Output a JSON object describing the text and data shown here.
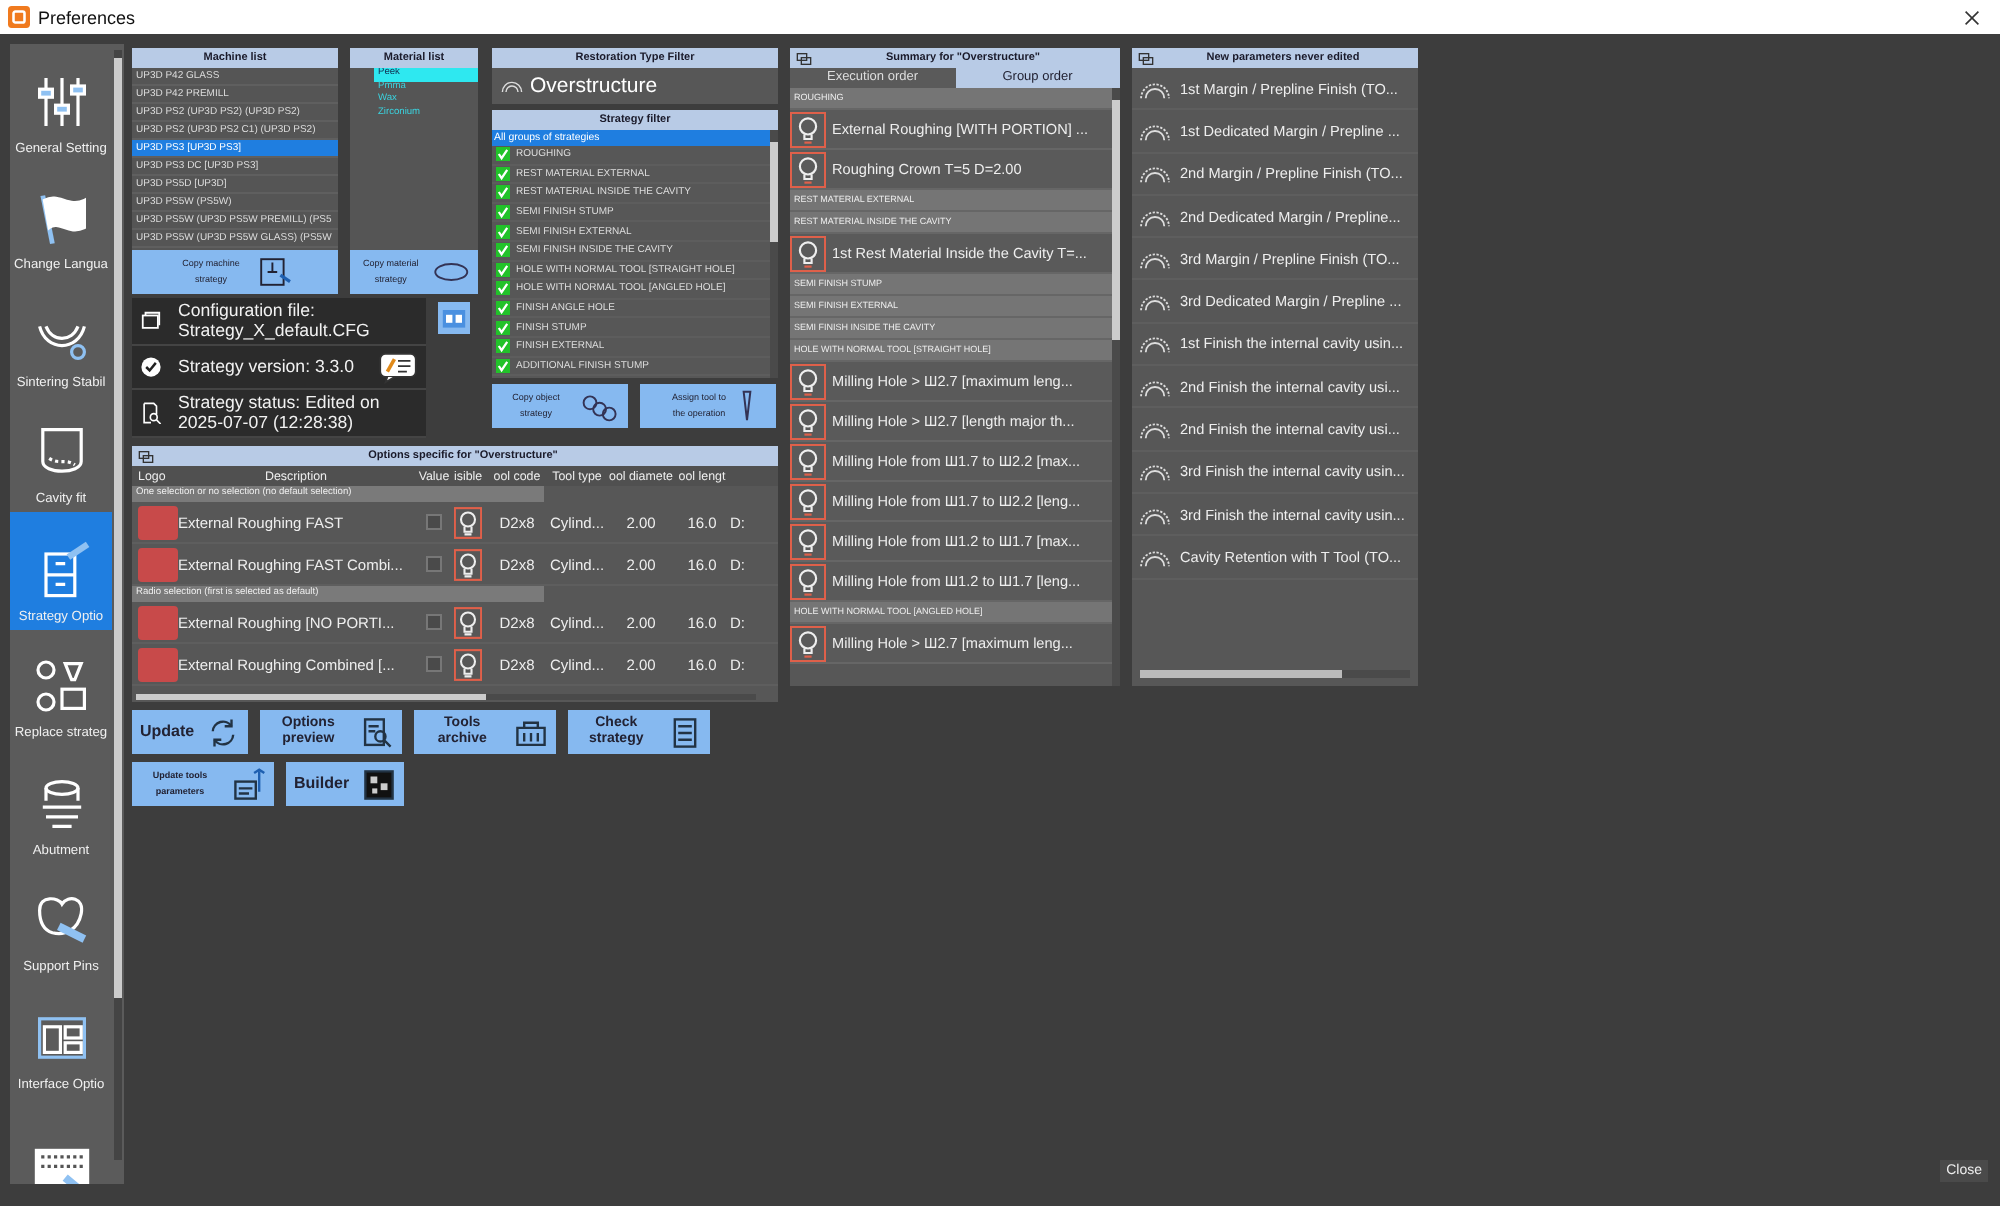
{
  "window": {
    "title": "Preferences"
  },
  "sidebar": {
    "items": [
      {
        "label": "General Setting",
        "kind": "sliders",
        "selected": false
      },
      {
        "label": "Change Langua",
        "kind": "flag",
        "selected": false
      },
      {
        "label": "Sintering Stabil",
        "kind": "teeth",
        "selected": false
      },
      {
        "label": "Cavity fit",
        "kind": "cavity",
        "selected": false
      },
      {
        "label": "Strategy Optio",
        "kind": "cabinet",
        "selected": true
      },
      {
        "label": "Replace strateg",
        "kind": "swap",
        "selected": false
      },
      {
        "label": "Abutment",
        "kind": "abutment",
        "selected": false
      },
      {
        "label": "Support Pins",
        "kind": "tooth",
        "selected": false
      },
      {
        "label": "Interface Optio",
        "kind": "layout",
        "selected": false
      },
      {
        "kind": "keyboard",
        "selected": false
      }
    ]
  },
  "machine_list": {
    "title": "Machine list",
    "items": [
      {
        "label": "UP3D P42 GLASS",
        "selected": false
      },
      {
        "label": "UP3D P42 PREMILL",
        "selected": false
      },
      {
        "label": "UP3D PS2 (UP3D PS2) (UP3D PS2)",
        "selected": false
      },
      {
        "label": "UP3D PS2 (UP3D PS2 C1) (UP3D PS2)",
        "selected": false
      },
      {
        "label": "UP3D PS3 [UP3D PS3]",
        "selected": true
      },
      {
        "label": "UP3D PS3 DC [UP3D PS3]",
        "selected": false
      },
      {
        "label": "UP3D PS5D [UP3D]",
        "selected": false
      },
      {
        "label": "UP3D PS5W (PS5W)",
        "selected": false
      },
      {
        "label": "UP3D PS5W (UP3D PS5W PREMILL) (PS5",
        "selected": false
      },
      {
        "label": "UP3D PS5W (UP3D PS5W GLASS) (PS5W",
        "selected": false
      }
    ],
    "button": "Copy machine strategy"
  },
  "material_list": {
    "title": "Material list",
    "items": [
      {
        "label": "Peek",
        "selected": true
      },
      {
        "label": "Pmma",
        "selected": false
      },
      {
        "label": "Wax",
        "selected": false
      },
      {
        "label": "Zirconium",
        "selected": false
      }
    ],
    "button": "Copy material strategy"
  },
  "configuration": {
    "file_label": "Configuration file:",
    "file": "Strategy_X_default.CFG",
    "version": "Strategy version: 3.3.0",
    "status_label": "Strategy status: Edited on",
    "status": "2025-07-07 (12:28:38)"
  },
  "restoration_filter": {
    "title": "Restoration Type Filter",
    "value": "Overstructure"
  },
  "strategy_filter": {
    "title": "Strategy filter",
    "all_item": {
      "label": "All groups of strategies",
      "selected": true
    },
    "items": [
      {
        "label": "ROUGHING",
        "checked": true
      },
      {
        "label": "REST MATERIAL EXTERNAL",
        "checked": true
      },
      {
        "label": "REST MATERIAL INSIDE THE CAVITY",
        "checked": true
      },
      {
        "label": "SEMI FINISH STUMP",
        "checked": true
      },
      {
        "label": "SEMI FINISH EXTERNAL",
        "checked": true
      },
      {
        "label": "SEMI FINISH INSIDE THE CAVITY",
        "checked": true
      },
      {
        "label": "HOLE WITH NORMAL TOOL [STRAIGHT HOLE]",
        "checked": true
      },
      {
        "label": "HOLE WITH NORMAL TOOL [ANGLED HOLE]",
        "checked": true
      },
      {
        "label": "FINISH ANGLE HOLE",
        "checked": true
      },
      {
        "label": "FINISH STUMP",
        "checked": true
      },
      {
        "label": "FINISH EXTERNAL",
        "checked": true
      },
      {
        "label": "ADDITIONAL FINISH STUMP",
        "checked": true
      }
    ]
  },
  "object_buttons": [
    {
      "label": "Copy object strategy",
      "kind": "copy"
    },
    {
      "label": "Assign tool to the operation",
      "kind": "tool"
    }
  ],
  "options": {
    "title": "Options specific for \"Overstructure\"",
    "columns": [
      "Logo",
      "Description",
      "Value",
      "isible",
      "ool code",
      "Tool type",
      "ool diamete",
      "ool lengt"
    ],
    "rows": [
      {
        "kind": "group",
        "label": "One selection or no selection (no default selection)"
      },
      {
        "kind": "option",
        "description": "External Roughing FAST",
        "checked": false,
        "code": "D2x8",
        "type": "Cylind...",
        "diameter": "2.00",
        "length": "16.0",
        "column_9": "D:"
      },
      {
        "kind": "option",
        "description": "External Roughing FAST Combi...",
        "checked": false,
        "code": "D2x8",
        "type": "Cylind...",
        "diameter": "2.00",
        "length": "16.0",
        "column_9": "D:"
      },
      {
        "kind": "group",
        "label": "Radio selection (first is selected as default)"
      },
      {
        "kind": "option",
        "description": "External Roughing  [NO PORTI...",
        "checked": false,
        "code": "D2x8",
        "type": "Cylind...",
        "diameter": "2.00",
        "length": "16.0",
        "column_9": "D:"
      },
      {
        "kind": "option",
        "description": "External Roughing Combined [...",
        "checked": false,
        "code": "D2x8",
        "type": "Cylind...",
        "diameter": "2.00",
        "length": "16.0",
        "column_9": "D:"
      }
    ]
  },
  "actions": [
    {
      "label": "Update",
      "kind": "update"
    },
    {
      "label": "Options preview",
      "kind": "preview"
    },
    {
      "label": "Tools archive",
      "kind": "archive"
    },
    {
      "label": "Check strategy",
      "kind": "check"
    },
    {
      "label": "Update tools parameters",
      "kind": "params"
    },
    {
      "label": "Builder",
      "kind": "builder"
    }
  ],
  "summary": {
    "title": "Summary for \"Overstructure\"",
    "tabs": [
      {
        "label": "Execution order",
        "selected": false
      },
      {
        "label": "Group order",
        "selected": true
      }
    ],
    "rows": [
      {
        "kind": "group",
        "label": "ROUGHING"
      },
      {
        "kind": "item",
        "label": "External Roughing  [WITH PORTION]  ..."
      },
      {
        "kind": "item",
        "label": "Roughing Crown  T=5 D=2.00"
      },
      {
        "kind": "group",
        "label": "REST MATERIAL EXTERNAL"
      },
      {
        "kind": "group",
        "label": "REST MATERIAL INSIDE THE CAVITY"
      },
      {
        "kind": "item",
        "label": "1st Rest Material Inside the Cavity  T=..."
      },
      {
        "kind": "group",
        "label": "SEMI FINISH STUMP"
      },
      {
        "kind": "group",
        "label": "SEMI FINISH EXTERNAL"
      },
      {
        "kind": "group",
        "label": "SEMI FINISH INSIDE THE CAVITY"
      },
      {
        "kind": "group",
        "label": "HOLE WITH NORMAL TOOL [STRAIGHT HOLE]"
      },
      {
        "kind": "item",
        "label": "Milling Hole  > Ш2.7 [maximum leng..."
      },
      {
        "kind": "item",
        "label": "Milling Hole  > Ш2.7 [length major th..."
      },
      {
        "kind": "item",
        "label": "Milling Hole from Ш1.7 to Ш2.2 [max..."
      },
      {
        "kind": "item",
        "label": "Milling Hole from Ш1.7 to Ш2.2 [leng..."
      },
      {
        "kind": "item",
        "label": "Milling Hole from Ш1.2 to Ш1.7 [max..."
      },
      {
        "kind": "item",
        "label": "Milling Hole from Ш1.2 to Ш1.7 [leng..."
      },
      {
        "kind": "group",
        "label": "HOLE WITH NORMAL TOOL [ANGLED HOLE]"
      },
      {
        "kind": "item",
        "label": "Milling Hole  > Ш2.7 [maximum leng..."
      }
    ]
  },
  "new_parameters": {
    "title": "New parameters never edited",
    "items": [
      "1st Margin / Prepline Finish (TO...",
      "1st Dedicated Margin / Prepline ...",
      "2nd Margin / Prepline Finish (TO...",
      "2nd Dedicated Margin / Prepline...",
      "3rd Margin / Prepline Finish (TO...",
      "3rd Dedicated Margin / Prepline ...",
      "1st Finish the internal cavity usin...",
      "2nd Finish the internal cavity usi...",
      "2nd Finish the internal cavity usi...",
      "3rd Finish the internal cavity usin...",
      "3rd Finish the internal cavity usin...",
      "Cavity Retention with T Tool (TO..."
    ]
  },
  "close_button": "Close"
}
